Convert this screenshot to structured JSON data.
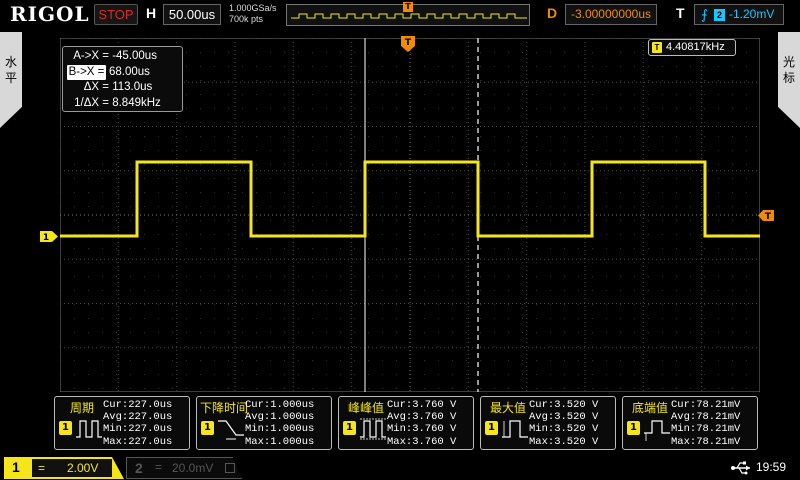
{
  "brand": "RIGOL",
  "top": {
    "run_status": "STOP",
    "h_label": "H",
    "timebase": "50.00us",
    "sample_rate": "1.000GSa/s",
    "mem_depth": "700k pts",
    "delay_label": "D",
    "trigger_delay": "-3.00000000us",
    "trigger_label": "T",
    "trigger_source": "2",
    "trigger_level": "-1.20mV"
  },
  "side_tabs": {
    "left": "水\n平",
    "right": "光\n标"
  },
  "cursor": {
    "rows": [
      {
        "label": "A->X =",
        "value": "-45.00us",
        "selected": false
      },
      {
        "label": "B->X =",
        "value": "68.00us",
        "selected": true
      },
      {
        "label": "ΔX =",
        "value": "113.0us",
        "selected": false
      },
      {
        "label": "1/ΔX =",
        "value": "8.849kHz",
        "selected": false
      }
    ]
  },
  "frequency_counter": "4.40817kHz",
  "channel_marker": "1",
  "trigger_marker": "T",
  "measurements": [
    {
      "title": "周期",
      "channel": "1",
      "icon": "period-icon",
      "cur": "Cur:227.0us",
      "avg": "Avg:227.0us",
      "min": "Min:227.0us",
      "max": "Max:227.0us"
    },
    {
      "title": "下降时间",
      "channel": "1",
      "icon": "fall-time-icon",
      "cur": "Cur:1.000us",
      "avg": "Avg:1.000us",
      "min": "Min:1.000us",
      "max": "Max:1.000us"
    },
    {
      "title": "峰峰值",
      "channel": "1",
      "icon": "peak-to-peak-icon",
      "cur": "Cur:3.760 V",
      "avg": "Avg:3.760 V",
      "min": "Min:3.760 V",
      "max": "Max:3.760 V"
    },
    {
      "title": "最大值",
      "channel": "1",
      "icon": "maximum-icon",
      "cur": "Cur:3.520 V",
      "avg": "Avg:3.520 V",
      "min": "Min:3.520 V",
      "max": "Max:3.520 V"
    },
    {
      "title": "底端值",
      "channel": "1",
      "icon": "base-value-icon",
      "cur": "Cur:78.21mV",
      "avg": "Avg:78.21mV",
      "min": "Min:78.21mV",
      "max": "Max:78.21mV"
    }
  ],
  "channels": [
    {
      "num": "1",
      "coupling": "=",
      "scale": "2.00V",
      "active": true,
      "color": "#f5e61c"
    },
    {
      "num": "2",
      "coupling": "=",
      "scale": "20.0mV",
      "active": false,
      "color": "#19c6ff"
    }
  ],
  "clock": "19:59",
  "colors": {
    "ch1": "#f5e61c",
    "trigger": "#f08c00",
    "ch2": "#19c6ff",
    "stop": "#e02828"
  }
}
